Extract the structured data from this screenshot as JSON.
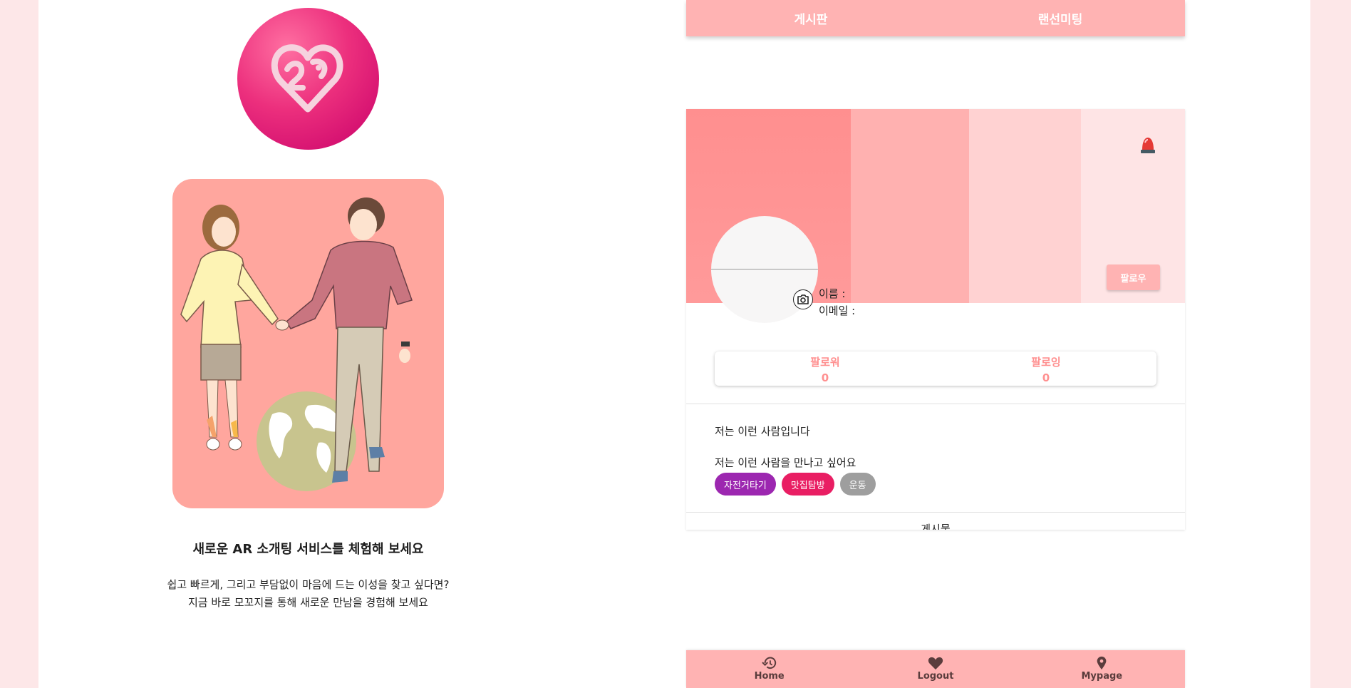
{
  "intro": {
    "title": "새로운 AR 소개팅 서비스를 체험해 보세요",
    "line1": "쉽고 빠르게, 그리고 부담없이 마음에 드는 이성을 찾고 싶다면?",
    "line2": "지금 바로 모꼬지를 통해 새로운 만남을 경험해 보세요"
  },
  "topnav": {
    "tab1": "게시판",
    "tab2": "랜선미팅"
  },
  "profile": {
    "follow_button": "팔로우",
    "name_label": "이름 :",
    "email_label": "이메일 :",
    "followers_label": "팔로워",
    "followers_count": "0",
    "following_label": "팔로잉",
    "following_count": "0",
    "intro_self": "저는 이런 사람입니다",
    "intro_want": "저는 이런 사람을 만나고 싶어요",
    "tags": [
      {
        "label": "자전거타기",
        "color": "#9c27b0"
      },
      {
        "label": "맛집탐방",
        "color": "#e91e63"
      },
      {
        "label": "운동",
        "color": "#9e9e9e"
      }
    ],
    "posts_heading": "게시물"
  },
  "bottomnav": {
    "home": "Home",
    "logout": "Logout",
    "mypage": "Mypage"
  },
  "colors": {
    "accent": "#ffb3b3",
    "follow_text": "#ff9090",
    "page_bg": "#fde7e8"
  }
}
